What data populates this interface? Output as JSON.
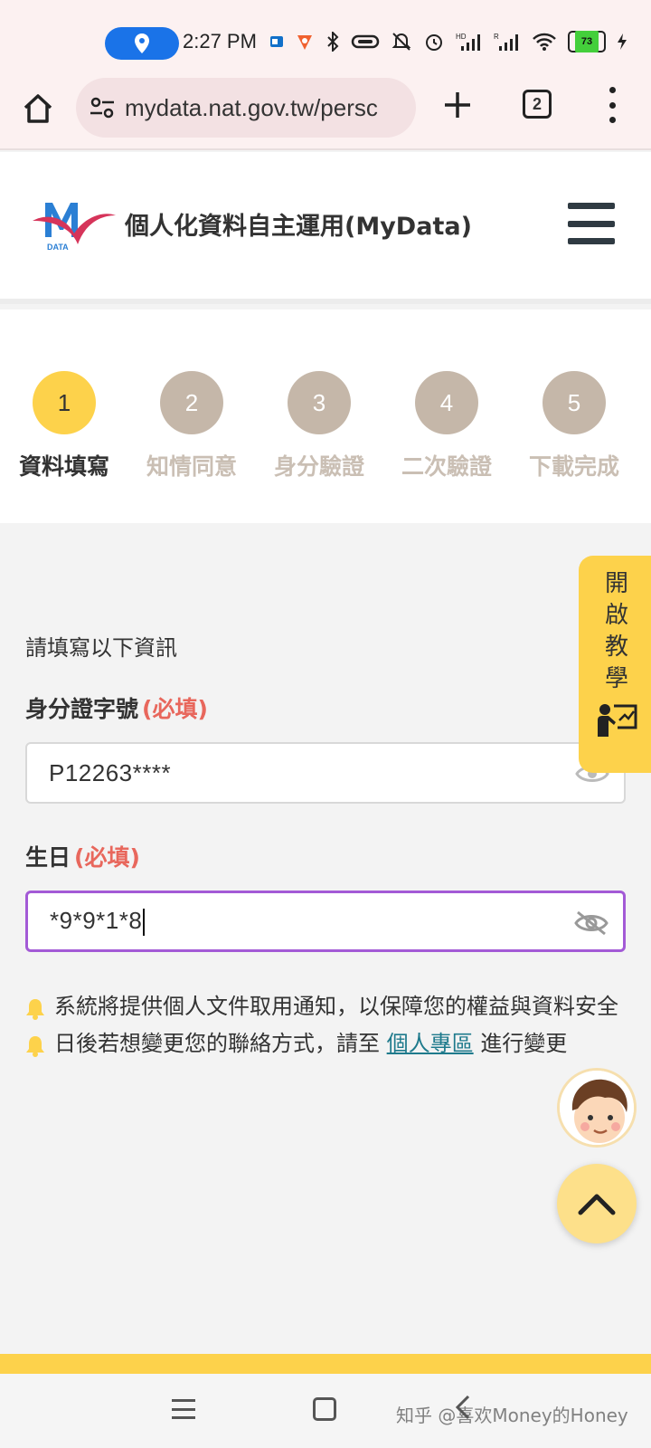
{
  "status_bar": {
    "time": "2:27 PM",
    "icons": [
      "location-icon",
      "outlook-icon",
      "app-icon",
      "bluetooth-icon",
      "vibrate-icon",
      "mute-icon",
      "alarm-icon",
      "signal-hd-icon",
      "signal-r-icon",
      "wifi-icon"
    ],
    "battery": "73"
  },
  "browser": {
    "url": "mydata.nat.gov.tw/persc",
    "tab_count": "2"
  },
  "header": {
    "title": "個人化資料自主運用(MyData)"
  },
  "steps": [
    {
      "number": "1",
      "label": "資料填寫",
      "active": true
    },
    {
      "number": "2",
      "label": "知情同意",
      "active": false
    },
    {
      "number": "3",
      "label": "身分驗證",
      "active": false
    },
    {
      "number": "4",
      "label": "二次驗證",
      "active": false
    },
    {
      "number": "5",
      "label": "下載完成",
      "active": false
    }
  ],
  "form": {
    "intro": "請填寫以下資訊",
    "id_label": "身分證字號",
    "id_required": "(必填)",
    "id_value": "P12263****",
    "birthday_label": "生日",
    "birthday_required": "(必填)",
    "birthday_value": "*9*9*1*8"
  },
  "notes": {
    "note1": "系統將提供個人文件取用通知，以保障您的權益與資料安全",
    "note2_before": "日後若想變更您的聯絡方式，請至 ",
    "note2_link": "個人專區",
    "note2_after": " 進行變更"
  },
  "tutorial": {
    "label": "開啟教學"
  },
  "watermark": "知乎 @喜欢Money的Honey",
  "colors": {
    "accent_yellow": "#fdd24b",
    "inactive_step": "#c5b7a9",
    "required_red": "#e8675c",
    "focus_purple": "#a35ad6",
    "link_teal": "#1e7a8c"
  }
}
